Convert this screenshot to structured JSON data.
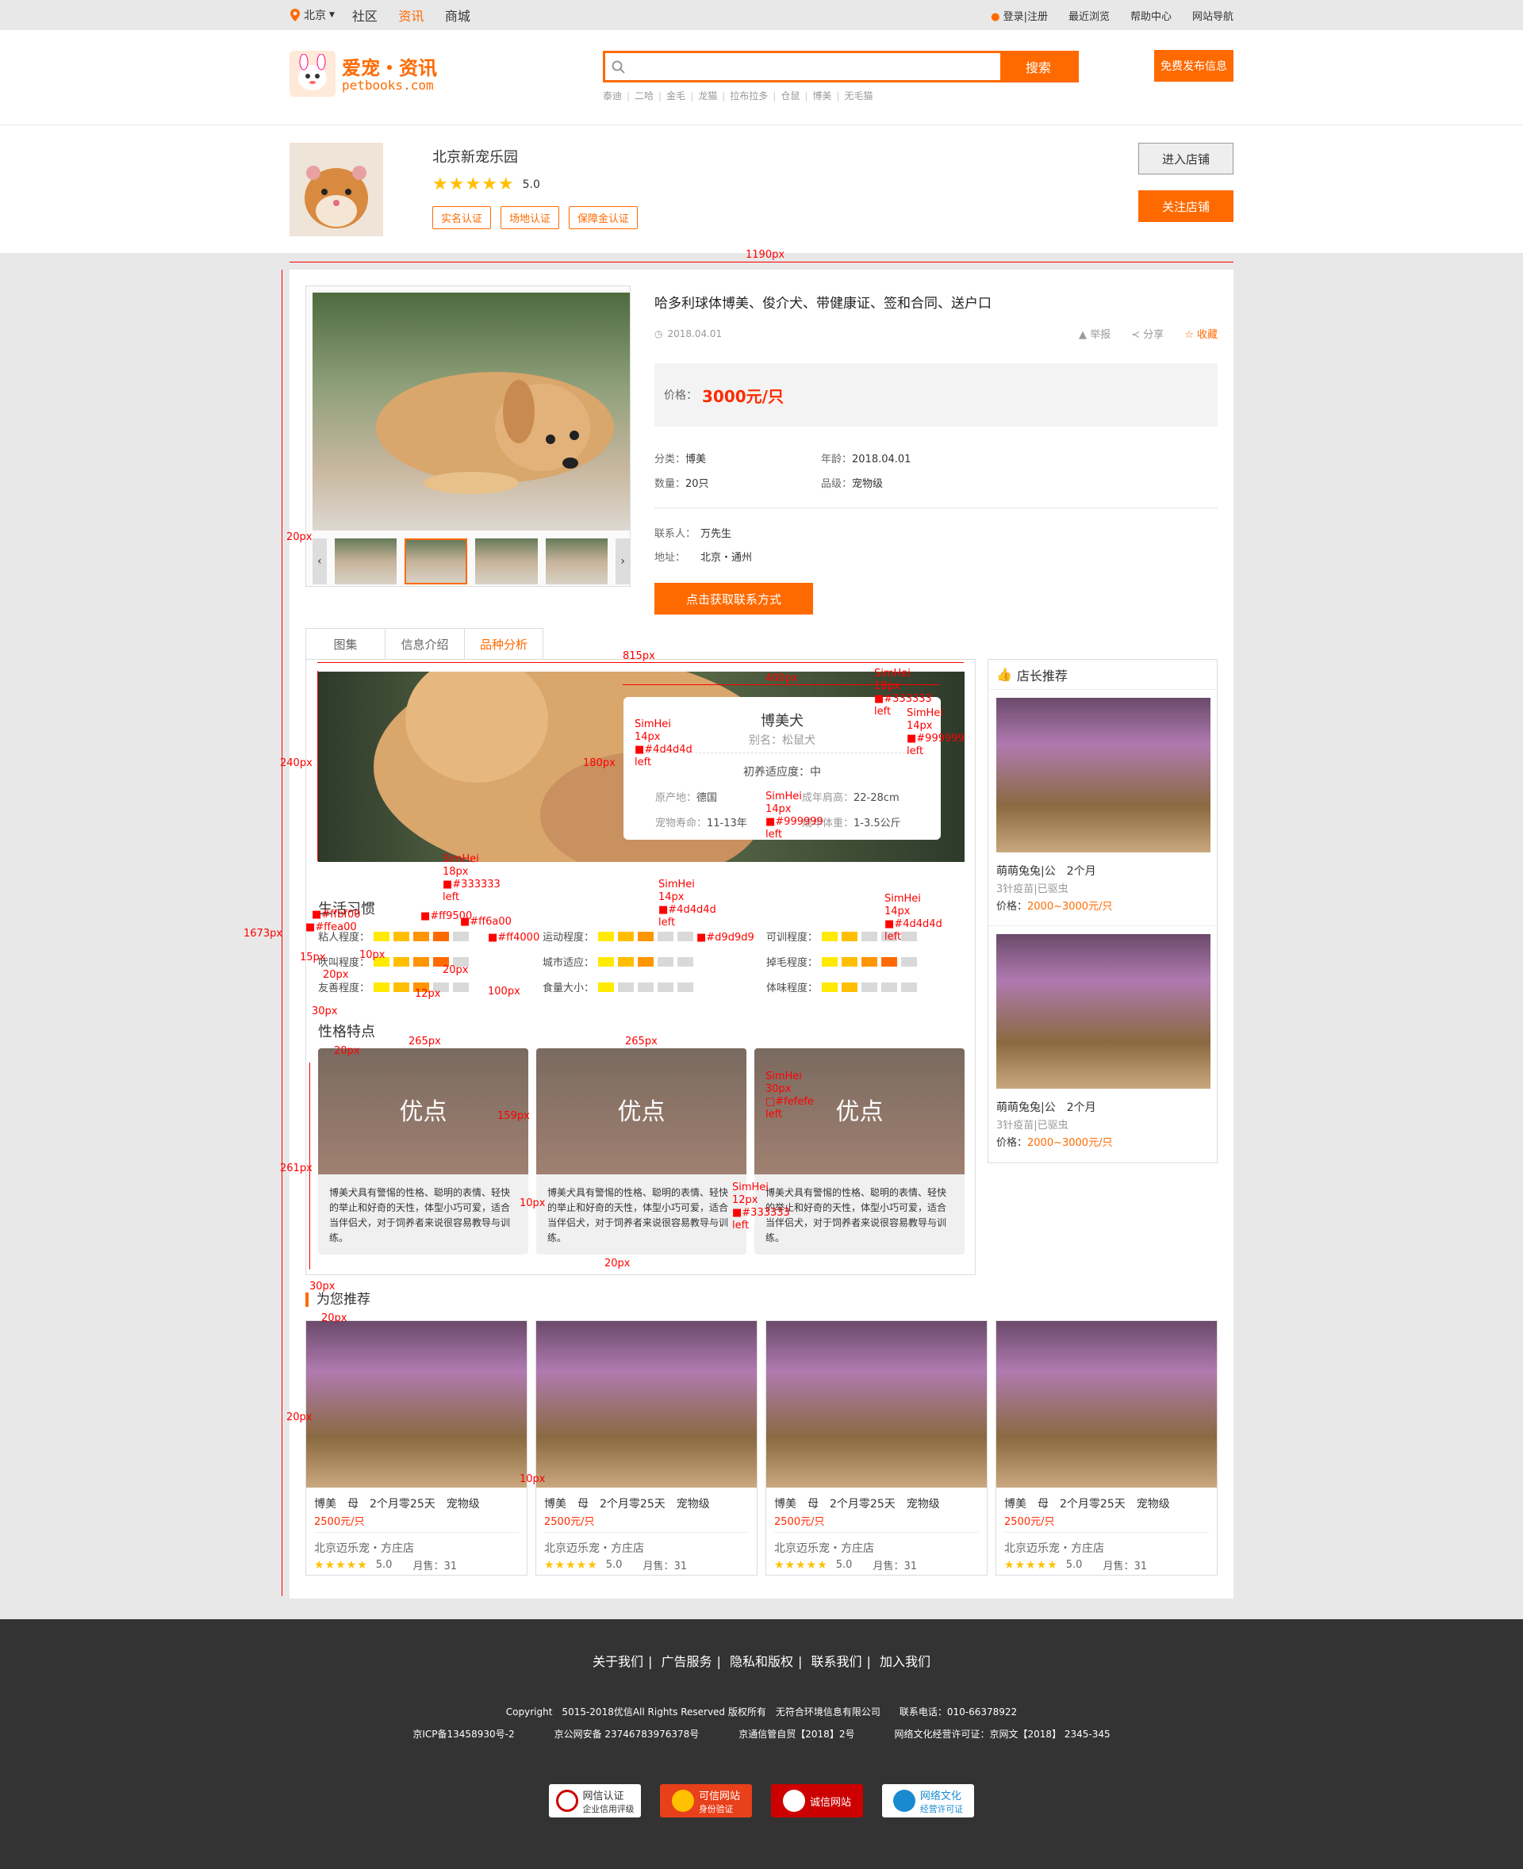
{
  "topbar": {
    "city": "北京",
    "nav": [
      "社区",
      "资讯",
      "商城"
    ],
    "active_nav": "资讯",
    "right": [
      "登录|注册",
      "最近浏览",
      "帮助中心",
      "网站导航"
    ]
  },
  "header": {
    "logo_title": "爱宠・资讯",
    "logo_domain": "petbooks.com",
    "search_button": "搜索",
    "search_placeholder": "",
    "hot_words": [
      "泰迪",
      "二哈",
      "金毛",
      "龙猫",
      "拉布拉多",
      "仓鼠",
      "博美",
      "无毛猫"
    ],
    "publish_button": "免费发布信息"
  },
  "shop": {
    "name": "北京新宠乐园",
    "stars": "★★★★★",
    "score": "5.0",
    "badges": [
      "实名认证",
      "场地认证",
      "保障金认证"
    ],
    "enter_button": "进入店铺",
    "follow_button": "关注店铺"
  },
  "product": {
    "title": "哈多利球体博美、俊介犬、带健康证、签和合同、送户口",
    "date": "2018.04.01",
    "actions": [
      "举报",
      "分享",
      "收藏"
    ],
    "price_label": "价格：",
    "price": "3000元/只",
    "specs": [
      {
        "k": "分类：",
        "v": "博美"
      },
      {
        "k": "年龄：",
        "v": "2018.04.01"
      },
      {
        "k": "数量：",
        "v": "20只"
      },
      {
        "k": "品级：",
        "v": "宠物级"
      }
    ],
    "contact_label": "联系人：",
    "contact": "万先生",
    "address_label": "地址：",
    "address": "北京・通州",
    "get_contact_button": "点击获取联系方式"
  },
  "tabs": [
    "图集",
    "信息介绍",
    "品种分析"
  ],
  "active_tab": "品种分析",
  "breed": {
    "name": "博美犬",
    "alias": "别名：松鼠犬",
    "level": "初养适应度：中",
    "origin_k": "原产地：",
    "origin": "德国",
    "height_k": "成年肩高：",
    "height": "22-28cm",
    "life_k": "宠物寿命：",
    "life": "11-13年",
    "weight_k": "成年体重：",
    "weight": "1-3.5公斤"
  },
  "habits": {
    "title": "生活习惯",
    "items": [
      {
        "label": "粘人程度：",
        "level": 4
      },
      {
        "label": "运动程度：",
        "level": 3
      },
      {
        "label": "可训程度：",
        "level": 2
      },
      {
        "label": "吠叫程度：",
        "level": 4
      },
      {
        "label": "城市适应：",
        "level": 3
      },
      {
        "label": "掉毛程度：",
        "level": 4
      },
      {
        "label": "友善程度：",
        "level": 3
      },
      {
        "label": "食量大小：",
        "level": 1
      },
      {
        "label": "体味程度：",
        "level": 2
      }
    ],
    "colors": [
      "#ffea00",
      "#ffbf00",
      "#ff9500",
      "#ff6a00",
      "#ff4000"
    ],
    "empty_color": "#d9d9d9"
  },
  "traits": {
    "title": "性格特点",
    "card_title": "优点",
    "text": "博美犬具有警惕的性格、聪明的表情、轻快的举止和好奇的天性，体型小巧可爱，适合当伴侣犬，对于饲养者来说很容易教导与训练。"
  },
  "recommend": {
    "title": "店长推荐",
    "items": [
      {
        "name": "萌萌兔兔|公　2个月",
        "vaccine": "3针疫苗|已驱虫",
        "price_label": "价格：",
        "price": "2000~3000元/只"
      },
      {
        "name": "萌萌兔兔|公　2个月",
        "vaccine": "3针疫苗|已驱虫",
        "price_label": "价格：",
        "price": "2000~3000元/只"
      }
    ]
  },
  "for_you": {
    "title": "为您推荐",
    "items": [
      {
        "name": "博美　母　2个月零25天　宠物级",
        "price": "2500元/只",
        "shop": "北京迈乐宠・方庄店",
        "stars": "★★★★★",
        "score": "5.0",
        "sales": "月售：31"
      },
      {
        "name": "博美　母　2个月零25天　宠物级",
        "price": "2500元/只",
        "shop": "北京迈乐宠・方庄店",
        "stars": "★★★★★",
        "score": "5.0",
        "sales": "月售：31"
      },
      {
        "name": "博美　母　2个月零25天　宠物级",
        "price": "2500元/只",
        "shop": "北京迈乐宠・方庄店",
        "stars": "★★★★★",
        "score": "5.0",
        "sales": "月售：31"
      },
      {
        "name": "博美　母　2个月零25天　宠物级",
        "price": "2500元/只",
        "shop": "北京迈乐宠・方庄店",
        "stars": "★★★★★",
        "score": "5.0",
        "sales": "月售：31"
      }
    ]
  },
  "footer": {
    "links": [
      "关于我们",
      "广告服务",
      "隐私和版权",
      "联系我们",
      "加入我们"
    ],
    "copyright": "Copyright　5015-2018优信All Rights Reserved 版权所有　无符合环境信息有限公司　　联系电话：010-66378922",
    "icp": [
      "京ICP备13458930号-2",
      "京公网安备 23746783976378号",
      "京通信管自贸【2018】2号",
      "网络文化经营许可证：京网文【2018】 2345-345"
    ],
    "certs": [
      {
        "a": "网信认证",
        "b": "企业信用评级"
      },
      {
        "a": "可信网站",
        "b": "身份验证"
      },
      {
        "a": "诚信网站",
        "b": ""
      },
      {
        "a": "网络文化",
        "b": "经营许可证"
      }
    ]
  },
  "annotations": {
    "w1190": "1190px",
    "w815": "815px",
    "w400": "400px",
    "h240": "240px",
    "h180": "180px",
    "h1673": "1673px",
    "h20a": "20px",
    "h261": "261px",
    "h159": "159px",
    "w265a": "265px",
    "w265b": "265px",
    "p15": "15px",
    "p10": "10px",
    "p20a": "20px",
    "p20b": "20px",
    "p30a": "30px",
    "p12": "12px",
    "w100": "100px",
    "p20c": "20px",
    "p10b": "10px",
    "p20d": "20px",
    "p30b": "30px",
    "p20e": "20px",
    "p20f": "20px",
    "p10c": "10px",
    "f_title": "SimHei\n18px\n■#333333\nleft",
    "f_alias": "SimHei\n14px\n■#999999\nleft",
    "f_row": "SimHei\n14px\n■#4d4d4d\nleft",
    "f_life": "SimHei\n14px\n■#999999\nleft",
    "f_habit": "SimHei\n18px\n■#333333\nleft",
    "c1": "■#ffea00",
    "c2": "■#ffbf00",
    "c3": "■#ff9500",
    "c4": "■#ff6a00",
    "c5": "■#ff4000",
    "c6": "■#d9d9d9",
    "f_sport": "SimHei\n14px\n■#4d4d4d\nleft",
    "f_train": "SimHei\n14px\n■#4d4d4d\nleft",
    "f_adv": "SimHei\n30px\n□#fefefe\nleft",
    "f_text": "SimHei\n12px\n■#333333\nleft"
  }
}
